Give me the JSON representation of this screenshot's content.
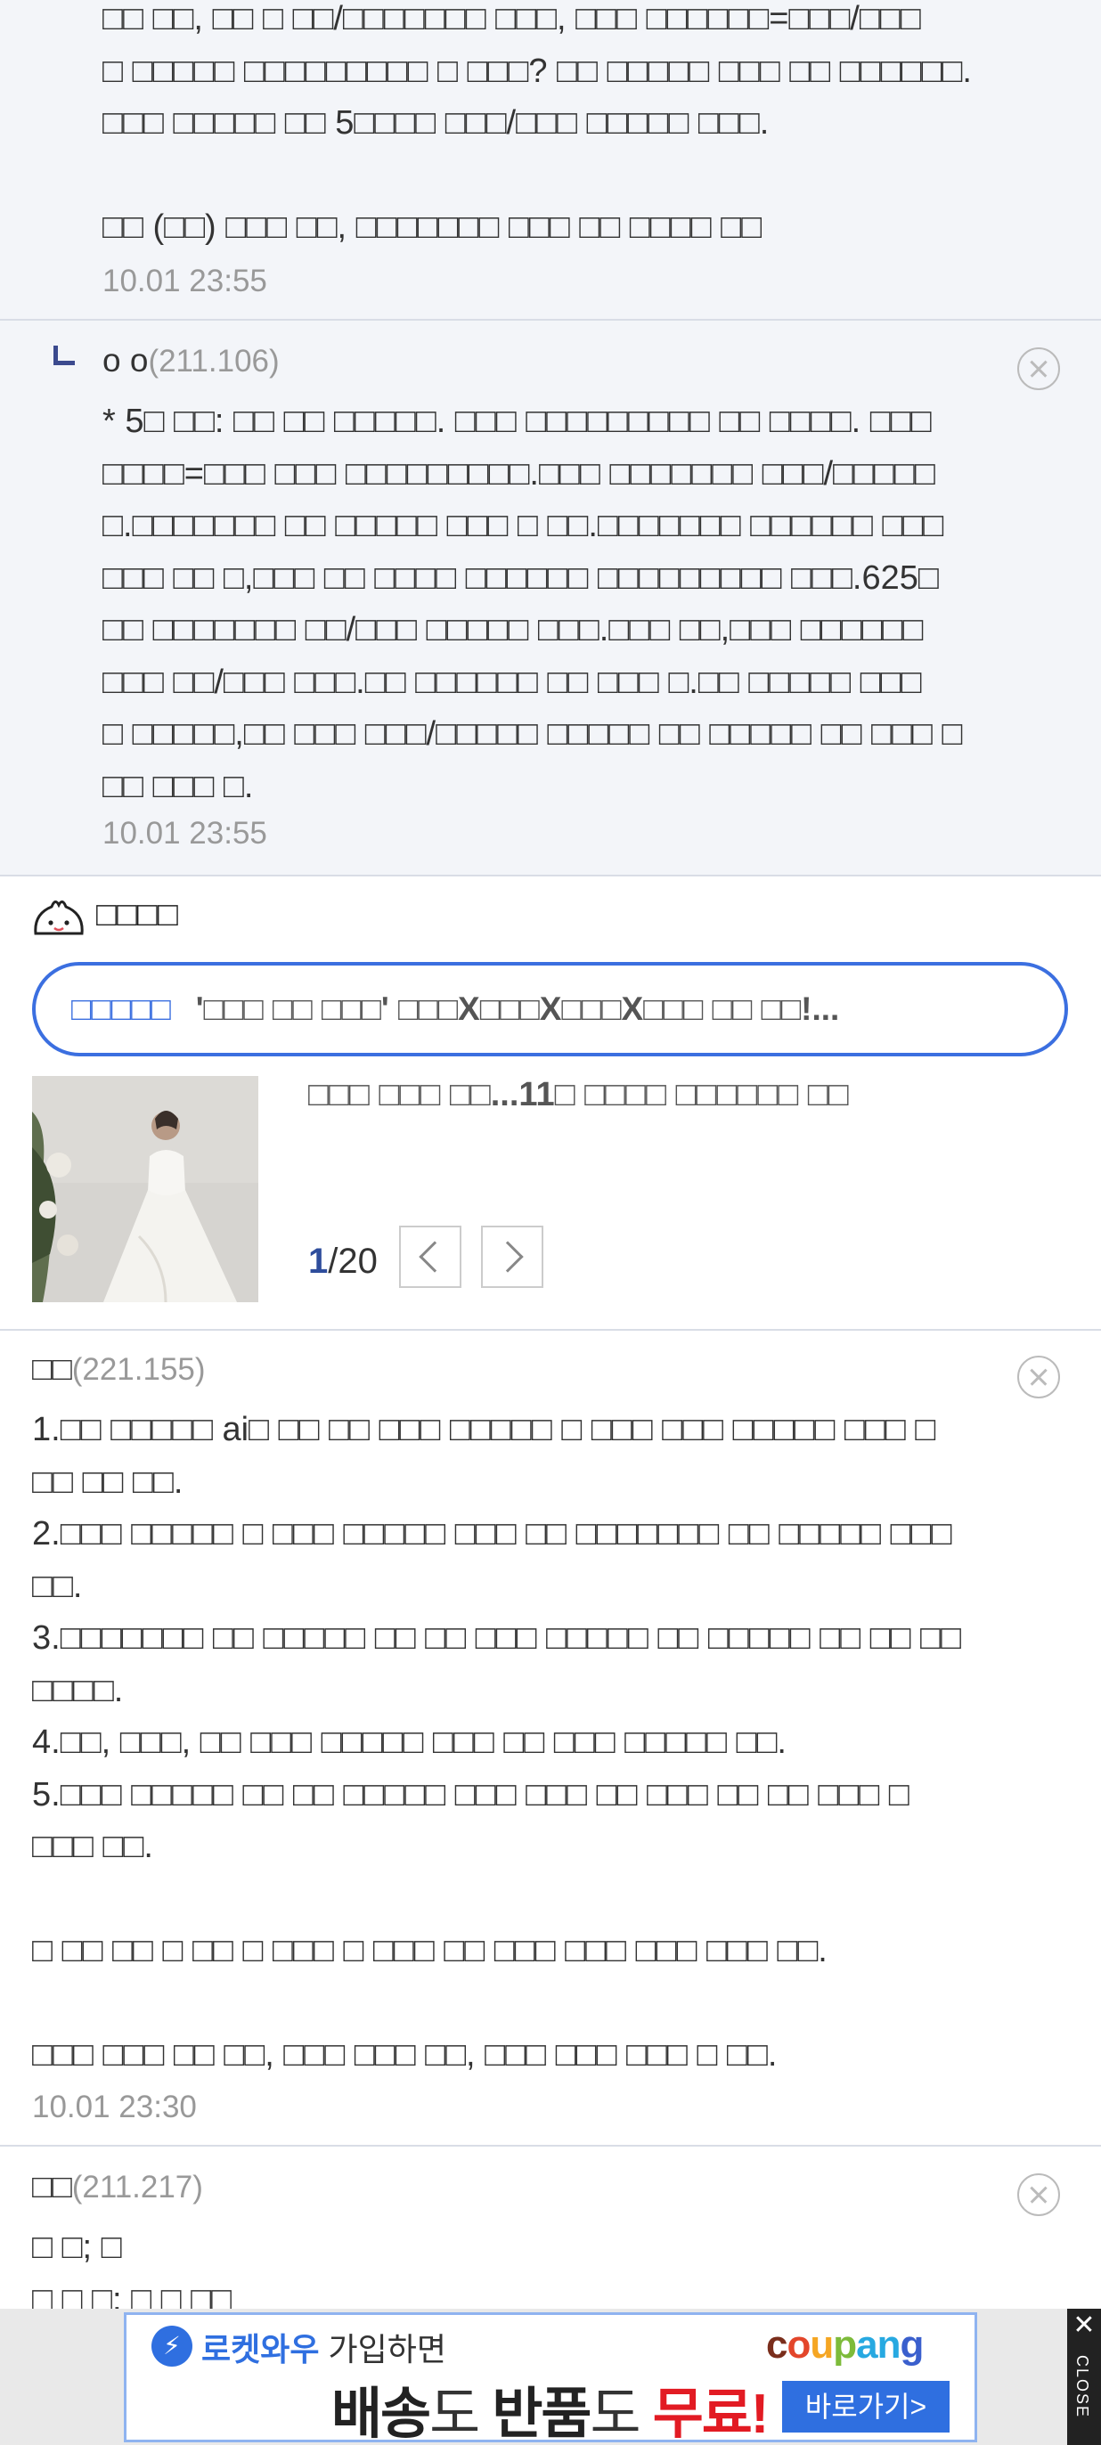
{
  "comments": [
    {
      "lines": [
        "□□ □□, □□ □ □□/□□□□□□□ □□□, □□□ □□□□□□=□□□/□□□",
        "□ □□□□□ □□□□□□□□□ □ □□□? □□ □□□□□ □□□ □□ □□□□□□.",
        "□□□ □□□□□ □□ 5□□□□ □□□/□□□ □□□□□ □□□.",
        "",
        "□□ (□□) □□□ □□, □□□□□□□ □□□ □□ □□□□ □□"
      ],
      "time": "10.01 23:55"
    },
    {
      "nick": "o o",
      "ip": "(211.106)",
      "lines": [
        "* 5□ □□: □□ □□ □□□□□. □□□ □□□□□□□□□ □□ □□□□. □□□",
        "□□□□=□□□ □□□ □□□□□□□□□.□□□ □□□□□□□ □□□/□□□□□",
        "□.□□□□□□□ □□ □□□□□ □□□ □ □□.□□□□□□□ □□□□□□ □□□",
        "□□□ □□ □,□□□ □□ □□□□ □□□□□□ □□□□□□□□□ □□□.625□",
        "□□ □□□□□□□ □□/□□□ □□□□□ □□□.□□□ □□,□□□ □□□□□□",
        "□□□ □□/□□□ □□□.□□ □□□□□□ □□ □□□ □.□□ □□□□□ □□□",
        "□ □□□□□,□□ □□□ □□□/□□□□□ □□□□□ □□ □□□□□ □□ □□□ □",
        "□□ □□□ □."
      ],
      "time": "10.01 23:55"
    },
    {
      "nick": "□□",
      "ip": "(221.155)",
      "lines": [
        "1.□□ □□□□□ ai□ □□ □□ □□□ □□□□□ □ □□□ □□□ □□□□□ □□□ □",
        "□□ □□ □□.",
        "2.□□□ □□□□□ □ □□□ □□□□□ □□□ □□ □□□□□□□ □□ □□□□□ □□□",
        "□□.",
        "3.□□□□□□□ □□ □□□□□ □□ □□ □□□ □□□□□ □□ □□□□□ □□ □□ □□",
        "□□□□.",
        "4.□□, □□□, □□ □□□ □□□□□ □□□ □□ □□□ □□□□□ □□.",
        "5.□□□ □□□□□ □□ □□ □□□□□ □□□ □□□ □□ □□□ □□ □□ □□□ □",
        "□□□ □□.",
        "",
        "□ □□ □□ □ □□ □ □□□ □ □□□ □□ □□□ □□□ □□□ □□□ □□.",
        "",
        "□□□ □□□ □□ □□, □□□ □□□ □□, □□□ □□□ □□□ □ □□."
      ],
      "time": "10.01 23:30"
    },
    {
      "nick": "□□",
      "ip": "(211.217)",
      "lines": [
        "□ □; □",
        "□ □ □; □ □ □□"
      ]
    }
  ],
  "news": {
    "section_title": "□□□□",
    "tag": "□□□□□",
    "headline": "'□□□ □□ □□□' □□□X□□□X□□□X□□□ □□ □□!...",
    "subhead": "□□□ □□□ □□...11□ □□□□ □□□□□□ □□",
    "page_current": "1",
    "page_total": "/20"
  },
  "ad": {
    "top_brand": "로켓와우",
    "top_text": " 가입하면",
    "brand": "coupang",
    "main_1": "배송",
    "main_2": "도 ",
    "main_3": "반품",
    "main_4": "도 ",
    "main_5": "무료!",
    "button": "바로가기>",
    "close_x": "✕",
    "close_label": "CLOSE"
  },
  "colors": {
    "reply_bg": "#f3f5f9",
    "accent_blue": "#3b6fe0",
    "pager_blue": "#2e4d9c",
    "ad_red": "#e21b23"
  }
}
